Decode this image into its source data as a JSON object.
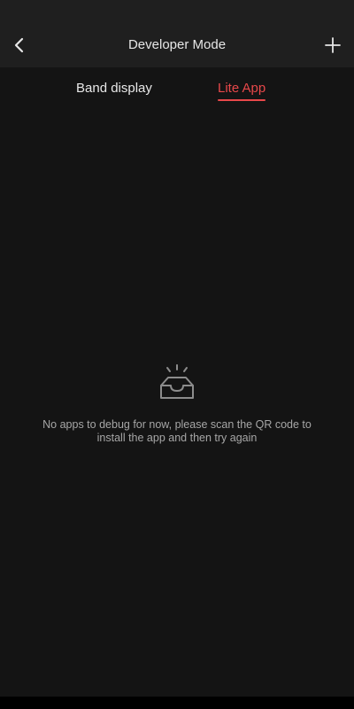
{
  "header": {
    "title": "Developer Mode",
    "back_icon": "chevron-left-icon",
    "add_icon": "plus-icon"
  },
  "tabs": [
    {
      "label": "Band display",
      "active": false
    },
    {
      "label": "Lite App",
      "active": true
    }
  ],
  "empty_state": {
    "icon": "empty-inbox-icon",
    "message": "No apps to debug for now, please scan the QR code to install the app and then try again"
  },
  "colors": {
    "accent": "#e8484a",
    "background": "#141414",
    "header_background": "#1f1f1f",
    "text_primary": "#e6e6e6",
    "text_secondary": "#a6a6a6"
  }
}
